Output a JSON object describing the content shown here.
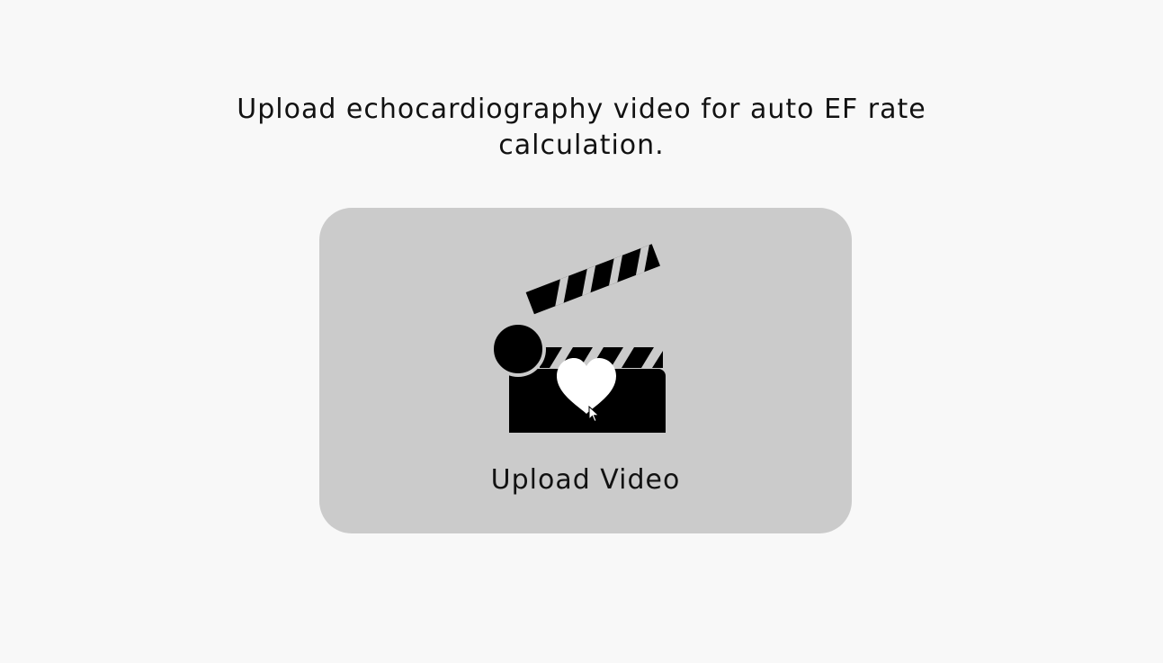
{
  "header": {
    "title": "Upload echocardiography video for auto EF rate calculation."
  },
  "upload": {
    "button_label": "Upload Video",
    "icon": "clapperboard-heart-icon"
  },
  "colors": {
    "background": "#f8f8f8",
    "card": "#cbcbcb",
    "text": "#121212",
    "icon": "#000000"
  }
}
